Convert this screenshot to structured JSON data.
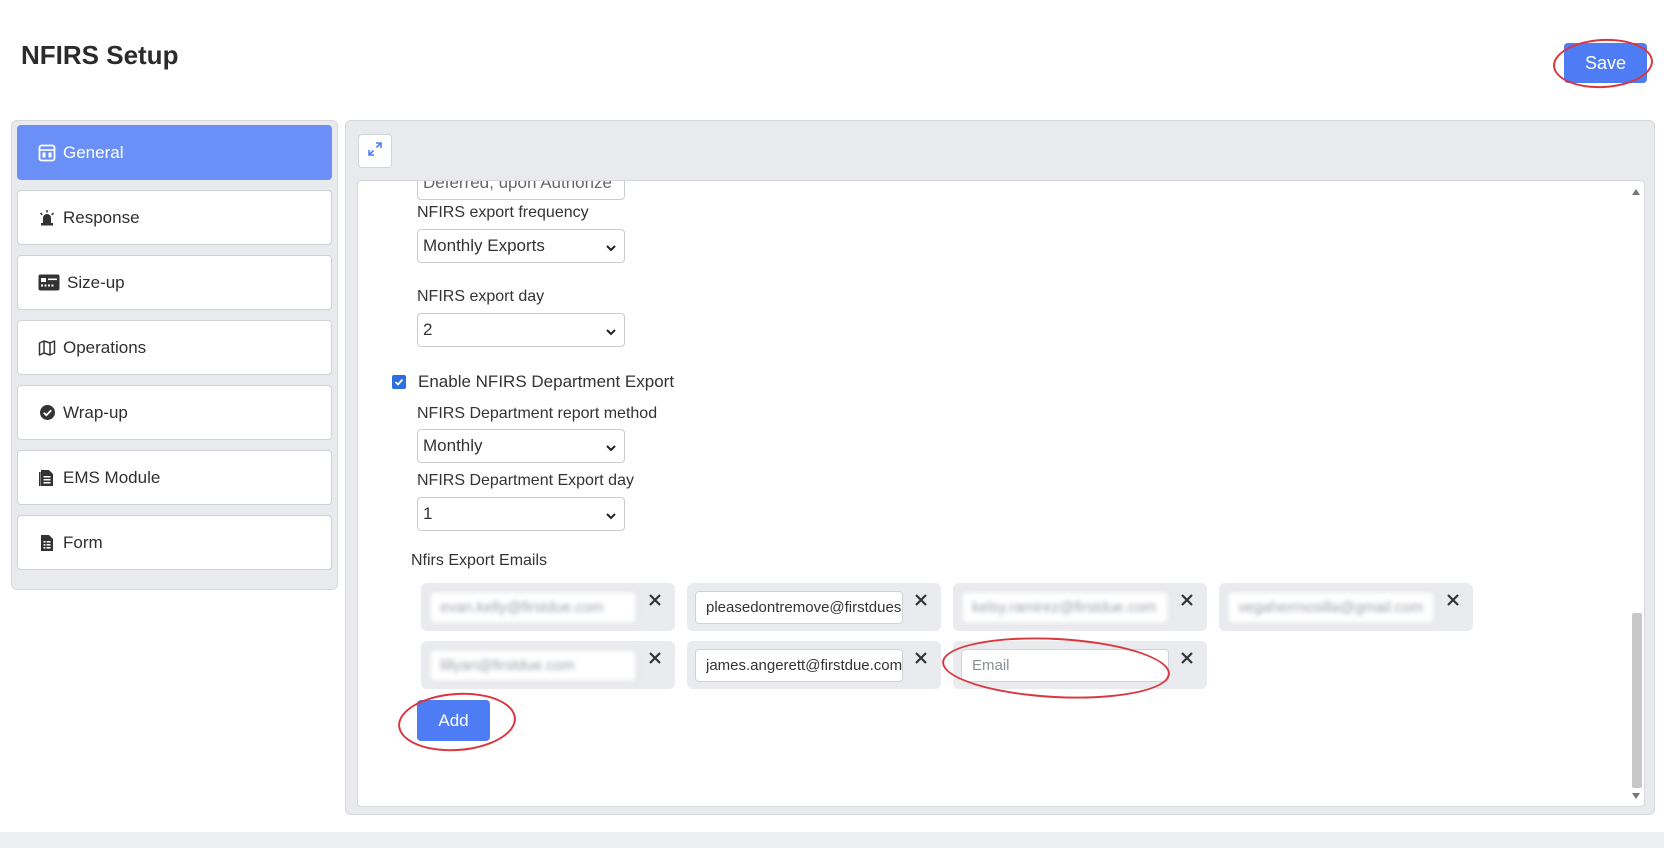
{
  "header": {
    "title": "NFIRS Setup",
    "save_label": "Save"
  },
  "sidebar": {
    "items": [
      {
        "label": "General",
        "icon": "dashboard-icon",
        "active": true
      },
      {
        "label": "Response",
        "icon": "siren-icon"
      },
      {
        "label": "Size-up",
        "icon": "id-card-icon"
      },
      {
        "label": "Operations",
        "icon": "map-icon"
      },
      {
        "label": "Wrap-up",
        "icon": "check-circle-icon"
      },
      {
        "label": "EMS Module",
        "icon": "document-icon"
      },
      {
        "label": "Form",
        "icon": "form-icon"
      }
    ]
  },
  "form": {
    "partial_select_value": "Deferred, upon Authorize",
    "export_frequency": {
      "label": "NFIRS export frequency",
      "value": "Monthly Exports"
    },
    "export_day": {
      "label": "NFIRS export day",
      "value": "2"
    },
    "dept_export": {
      "label": "Enable NFIRS Department Export",
      "checked": true
    },
    "dept_report_method": {
      "label": "NFIRS Department report method",
      "value": "Monthly"
    },
    "dept_export_day": {
      "label": "NFIRS Department Export day",
      "value": "1"
    },
    "emails_label": "Nfirs Export Emails",
    "emails": [
      {
        "value": "evan.kelly@firstdue.com",
        "blurred": true
      },
      {
        "value": "pleasedontremove@firstdues",
        "blurred": false
      },
      {
        "value": "kelsy.ramirez@firstdue.com",
        "blurred": true
      },
      {
        "value": "vegaherrnosilla@gmail.com",
        "blurred": true
      },
      {
        "value": "lillyan@firstdue.com",
        "blurred": true
      },
      {
        "value": "james.angerett@firstdue.com",
        "blurred": false
      },
      {
        "value": "",
        "placeholder": "Email",
        "blurred": false
      }
    ],
    "add_label": "Add"
  },
  "colors": {
    "accent": "#4d7cf5",
    "active_tab": "#6a90f7",
    "annotation": "#d9363e"
  }
}
